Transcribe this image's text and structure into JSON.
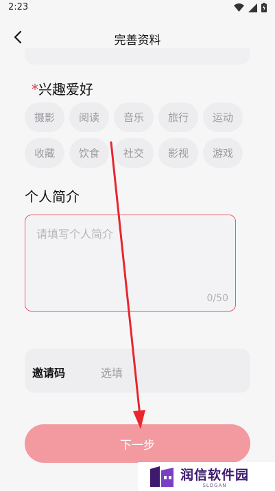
{
  "status_bar": {
    "time": "2:23"
  },
  "header": {
    "title": "完善资料"
  },
  "interests": {
    "required_mark": "*",
    "label": "兴趣爱好",
    "tags": [
      "摄影",
      "阅读",
      "音乐",
      "旅行",
      "运动",
      "收藏",
      "饮食",
      "社交",
      "影视",
      "游戏"
    ]
  },
  "intro": {
    "label": "个人简介",
    "placeholder": "请填写个人简介",
    "counter": "0/50"
  },
  "invite": {
    "label": "邀请码",
    "placeholder": "选填"
  },
  "next_button": {
    "label": "下一步"
  },
  "watermark": {
    "name": "润信软件园",
    "slogan": "SLOGAN"
  },
  "colors": {
    "accent": "#e65a66",
    "button": "#f29aa0",
    "annotation_arrow": "#e8262e"
  }
}
